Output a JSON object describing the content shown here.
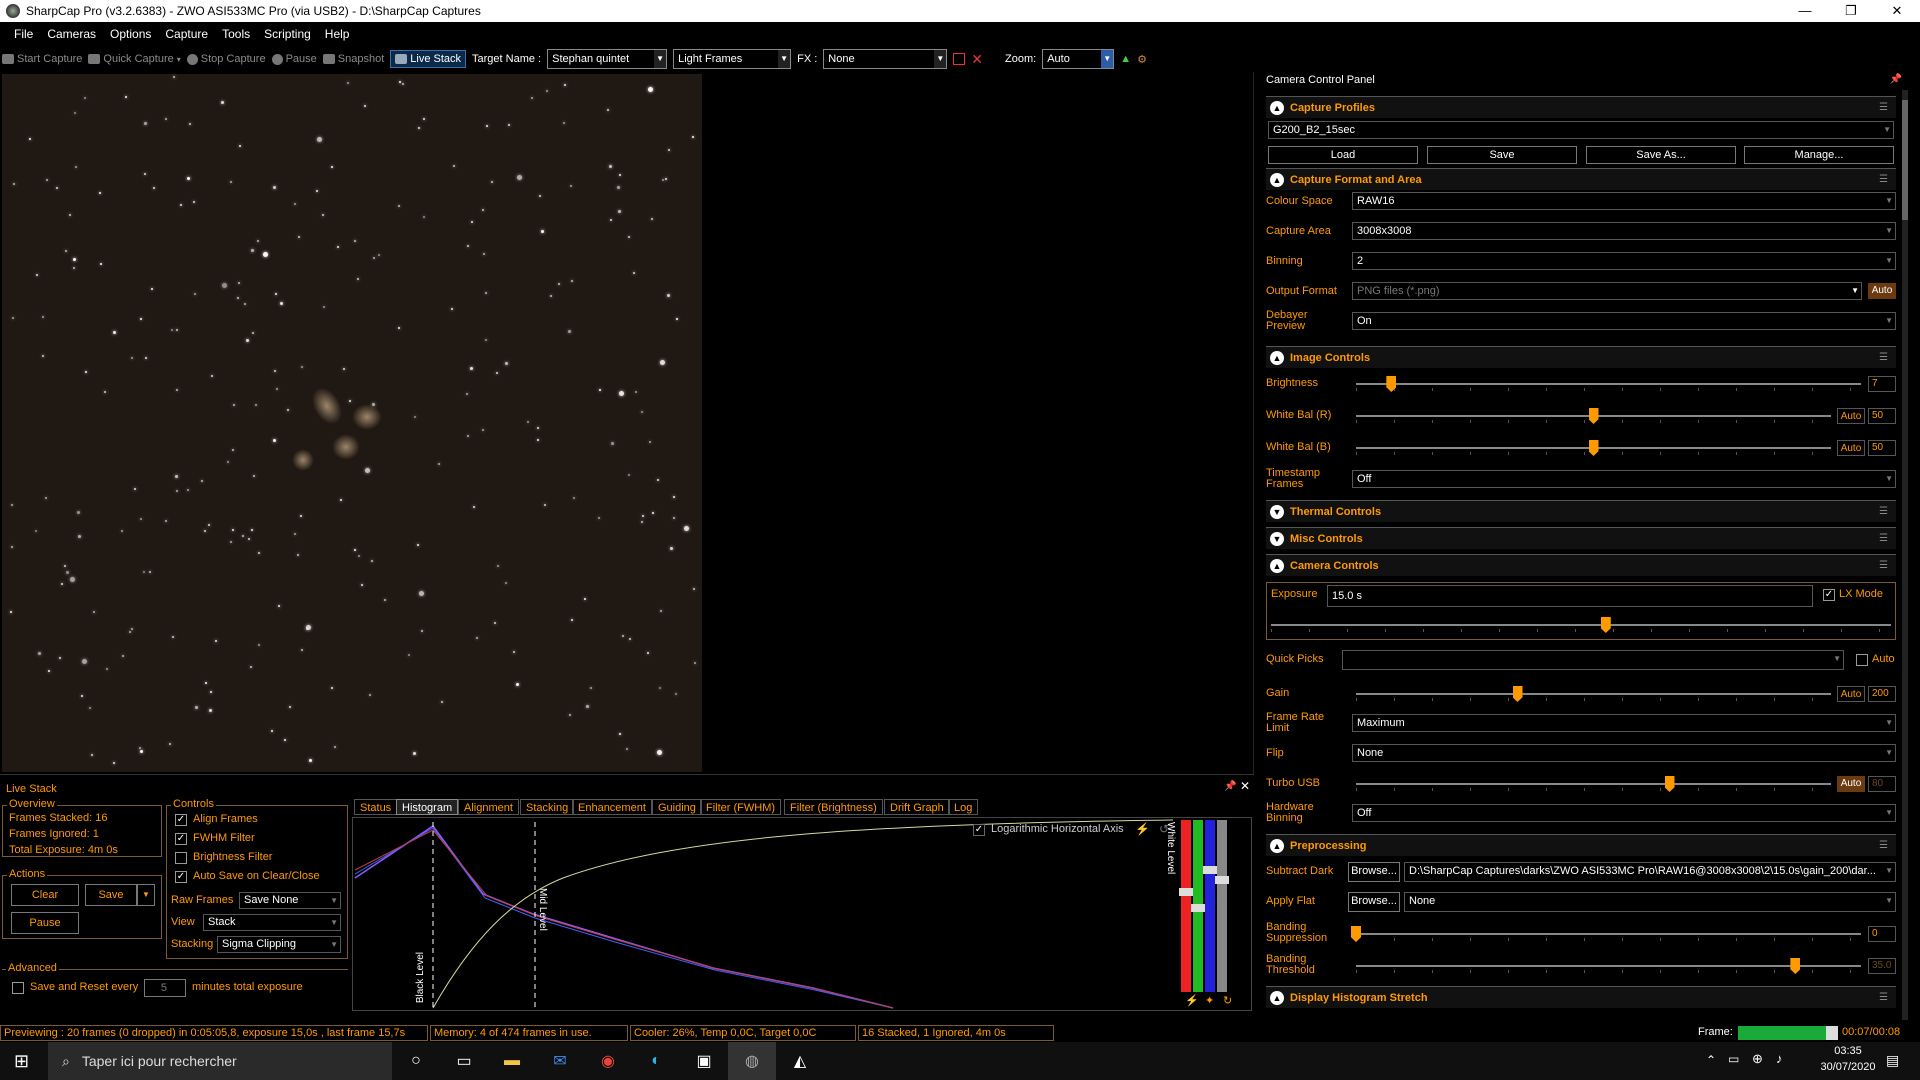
{
  "window": {
    "title": "SharpCap Pro (v3.2.6383) - ZWO ASI533MC Pro (via USB2) - D:\\SharpCap Captures",
    "minimize": "—",
    "restore": "❐",
    "close": "✕"
  },
  "menu": [
    "File",
    "Cameras",
    "Options",
    "Capture",
    "Tools",
    "Scripting",
    "Help"
  ],
  "toolbar": {
    "start_capture": "Start Capture",
    "quick_capture": "Quick Capture",
    "stop_capture": "Stop Capture",
    "pause": "Pause",
    "snapshot": "Snapshot",
    "live_stack": "Live Stack",
    "target_label": "Target Name :",
    "target_value": "Stephan quintet",
    "frame_type": "Light Frames",
    "fx_label": "FX :",
    "fx_value": "None",
    "zoom_label": "Zoom:",
    "zoom_value": "Auto"
  },
  "ccp": {
    "title": "Camera Control Panel",
    "capture_profiles": {
      "title": "Capture Profiles",
      "profile": "G200_B2_15sec",
      "load": "Load",
      "save": "Save",
      "save_as": "Save As...",
      "manage": "Manage..."
    },
    "format_area": {
      "title": "Capture Format and Area",
      "colour_space_label": "Colour Space",
      "colour_space": "RAW16",
      "capture_area_label": "Capture Area",
      "capture_area": "3008x3008",
      "binning_label": "Binning",
      "binning": "2",
      "output_format_label": "Output Format",
      "output_format": "PNG files (*.png)",
      "output_auto": "Auto",
      "debayer_label": "Debayer Preview",
      "debayer": "On"
    },
    "image_controls": {
      "title": "Image Controls",
      "brightness_label": "Brightness",
      "brightness": "7",
      "brightness_level": 0.07,
      "wbr_label": "White Bal (R)",
      "wbr": "50",
      "wbr_auto": "Auto",
      "wbr_level": 0.5,
      "wbb_label": "White Bal (B)",
      "wbb": "50",
      "wbb_auto": "Auto",
      "wbb_level": 0.5,
      "timestamp_label": "Timestamp Frames",
      "timestamp": "Off"
    },
    "thermal": {
      "title": "Thermal Controls"
    },
    "misc": {
      "title": "Misc Controls"
    },
    "camera_controls": {
      "title": "Camera Controls",
      "exposure_label": "Exposure",
      "exposure": "15.0 s",
      "lx_mode": "LX Mode",
      "exposure_level": 0.54,
      "quick_picks_label": "Quick Picks",
      "quick_auto": "Auto",
      "gain_label": "Gain",
      "gain": "200",
      "gain_auto": "Auto",
      "gain_level": 0.34,
      "frame_rate_label": "Frame Rate Limit",
      "frame_rate": "Maximum",
      "flip_label": "Flip",
      "flip": "None",
      "turbo_label": "Turbo USB",
      "turbo": "80",
      "turbo_auto": "Auto",
      "turbo_level": 0.66,
      "hw_binning_label": "Hardware Binning",
      "hw_binning": "Off"
    },
    "preprocessing": {
      "title": "Preprocessing",
      "subtract_dark_label": "Subtract Dark",
      "browse": "Browse...",
      "subtract_dark": "D:\\SharpCap Captures\\darks\\ZWO ASI533MC Pro\\RAW16@3008x3008\\2\\15.0s\\gain_200\\dar...",
      "apply_flat_label": "Apply Flat",
      "apply_flat": "None",
      "banding_supp_label": "Banding Suppression",
      "banding_supp": "0",
      "banding_supp_level": 0.0,
      "banding_thresh_label": "Banding Threshold",
      "banding_thresh": "35.0",
      "banding_thresh_level": 0.87
    },
    "histogram_stretch": {
      "title": "Display Histogram Stretch"
    }
  },
  "livestack": {
    "title": "Live Stack",
    "overview": {
      "title": "Overview",
      "frames_stacked": "Frames Stacked: 16",
      "frames_ignored": "Frames Ignored: 1",
      "total_exposure": "Total Exposure: 4m 0s"
    },
    "actions": {
      "title": "Actions",
      "clear": "Clear",
      "save": "Save",
      "pause": "Pause"
    },
    "advanced": {
      "title": "Advanced",
      "save_reset": "Save and Reset every",
      "minutes": "5",
      "minutes_label": "minutes total exposure"
    },
    "controls": {
      "title": "Controls",
      "align": "Align Frames",
      "fwhm": "FWHM Filter",
      "brightness": "Brightness Filter",
      "autosave": "Auto Save on Clear/Close",
      "raw_frames_label": "Raw Frames",
      "raw_frames": "Save None",
      "view_label": "View",
      "view": "Stack",
      "stacking_label": "Stacking",
      "stacking": "Sigma Clipping"
    },
    "tabs": [
      "Status",
      "Histogram",
      "Alignment",
      "Stacking",
      "Enhancement",
      "Guiding",
      "Filter (FWHM)",
      "Filter (Brightness)",
      "Drift Graph",
      "Log"
    ],
    "histogram": {
      "log_axis": "Logarithmic Horizontal Axis",
      "black_level": "Black Level",
      "mid_level": "Mid Level",
      "white_level": "White Level"
    }
  },
  "status": {
    "preview": "Previewing : 20 frames (0 dropped) in 0:05:05,8, exposure 15,0s , last frame 15,7s",
    "memory": "Memory: 4 of 474 frames in use.",
    "cooler": "Cooler: 26%, Temp 0,0C, Target 0,0C",
    "stacked": "16 Stacked, 1 Ignored, 4m 0s",
    "frame_label": "Frame:",
    "frame_time": "00:07/00:08",
    "frame_progress": 0.875
  },
  "taskbar": {
    "search": "Taper ici pour rechercher",
    "time": "03:35",
    "date": "30/07/2020"
  }
}
